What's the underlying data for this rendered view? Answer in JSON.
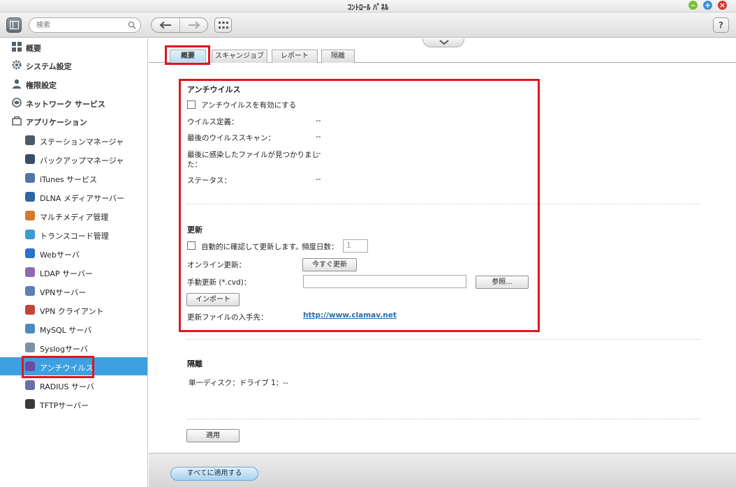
{
  "window": {
    "title": "ｺﾝﾄﾛｰﾙ ﾊﾟﾈﾙ"
  },
  "toolbar": {
    "search_placeholder": "検索",
    "help_label": "?"
  },
  "sidebar": {
    "top_items": [
      {
        "label": "概要",
        "icon": "overview-icon"
      },
      {
        "label": "システム設定",
        "icon": "gear-icon"
      },
      {
        "label": "権限設定",
        "icon": "user-icon"
      },
      {
        "label": "ネットワーク サービス",
        "icon": "network-icon"
      },
      {
        "label": "アプリケーション",
        "icon": "application-icon"
      }
    ],
    "app_items": [
      {
        "label": "ステーションマネージャ",
        "color": "#4a5a6a"
      },
      {
        "label": "バックアップマネージャ",
        "color": "#3c4d66"
      },
      {
        "label": "iTunes サービス",
        "color": "#5274a8"
      },
      {
        "label": "DLNA メディアサーバー",
        "color": "#2f63a6"
      },
      {
        "label": "マルチメディア管理",
        "color": "#d47a2e"
      },
      {
        "label": "トランスコード管理",
        "color": "#3d9bd2"
      },
      {
        "label": "Webサーバ",
        "color": "#2c73c8"
      },
      {
        "label": "LDAP サーバー",
        "color": "#8a6bb0"
      },
      {
        "label": "VPNサーバー",
        "color": "#5d7fb2"
      },
      {
        "label": "VPN クライアント",
        "color": "#c0453b"
      },
      {
        "label": "MySQL サーバ",
        "color": "#4a8cc0"
      },
      {
        "label": "Syslogサーバ",
        "color": "#7a8fa8"
      },
      {
        "label": "アンチウイルス",
        "color": "#6c4ca0",
        "active": true
      },
      {
        "label": "RADIUS サーバ",
        "color": "#6b6fa8"
      },
      {
        "label": "TFTPサーバー",
        "color": "#3a3a3a"
      }
    ]
  },
  "tabs": [
    "概要",
    "スキャンジョブ",
    "レポート",
    "隔離"
  ],
  "antivirus": {
    "title": "アンチウイルス",
    "enable_label": "アンチウイルスを有効にする",
    "definitions_label": "ウイルス定義：",
    "definitions_value": "--",
    "last_scan_label": "最後のウイルススキャン：",
    "last_scan_value": "--",
    "last_infected_label_line1": "最後に感染したファイルが見つかりまし",
    "last_infected_label_line2": "た：",
    "last_infected_value": "--",
    "status_label": "ステータス：",
    "status_value": "--"
  },
  "update": {
    "title": "更新",
    "auto_check_label": "自動的に確認して更新します。",
    "frequency_label": "頻度日数：",
    "frequency_value": "1",
    "online_label": "オンライン更新：",
    "update_now_label": "今すぐ更新",
    "manual_label": "手動更新 (*.cvd)：",
    "manual_value": "",
    "browse_label": "参照...",
    "import_label": "インポート",
    "source_label": "更新ファイルの入手先：",
    "source_link": "http://www.clamav.net"
  },
  "quarantine": {
    "title": "隔離",
    "single_disk_label": "単一ディスク：ドライブ 1：--"
  },
  "apply_label": "適用",
  "apply_all_label": "すべてに適用する",
  "colors": {
    "highlight": "#e0151f",
    "active": "#3da0e0",
    "link": "#1f6fb8"
  }
}
